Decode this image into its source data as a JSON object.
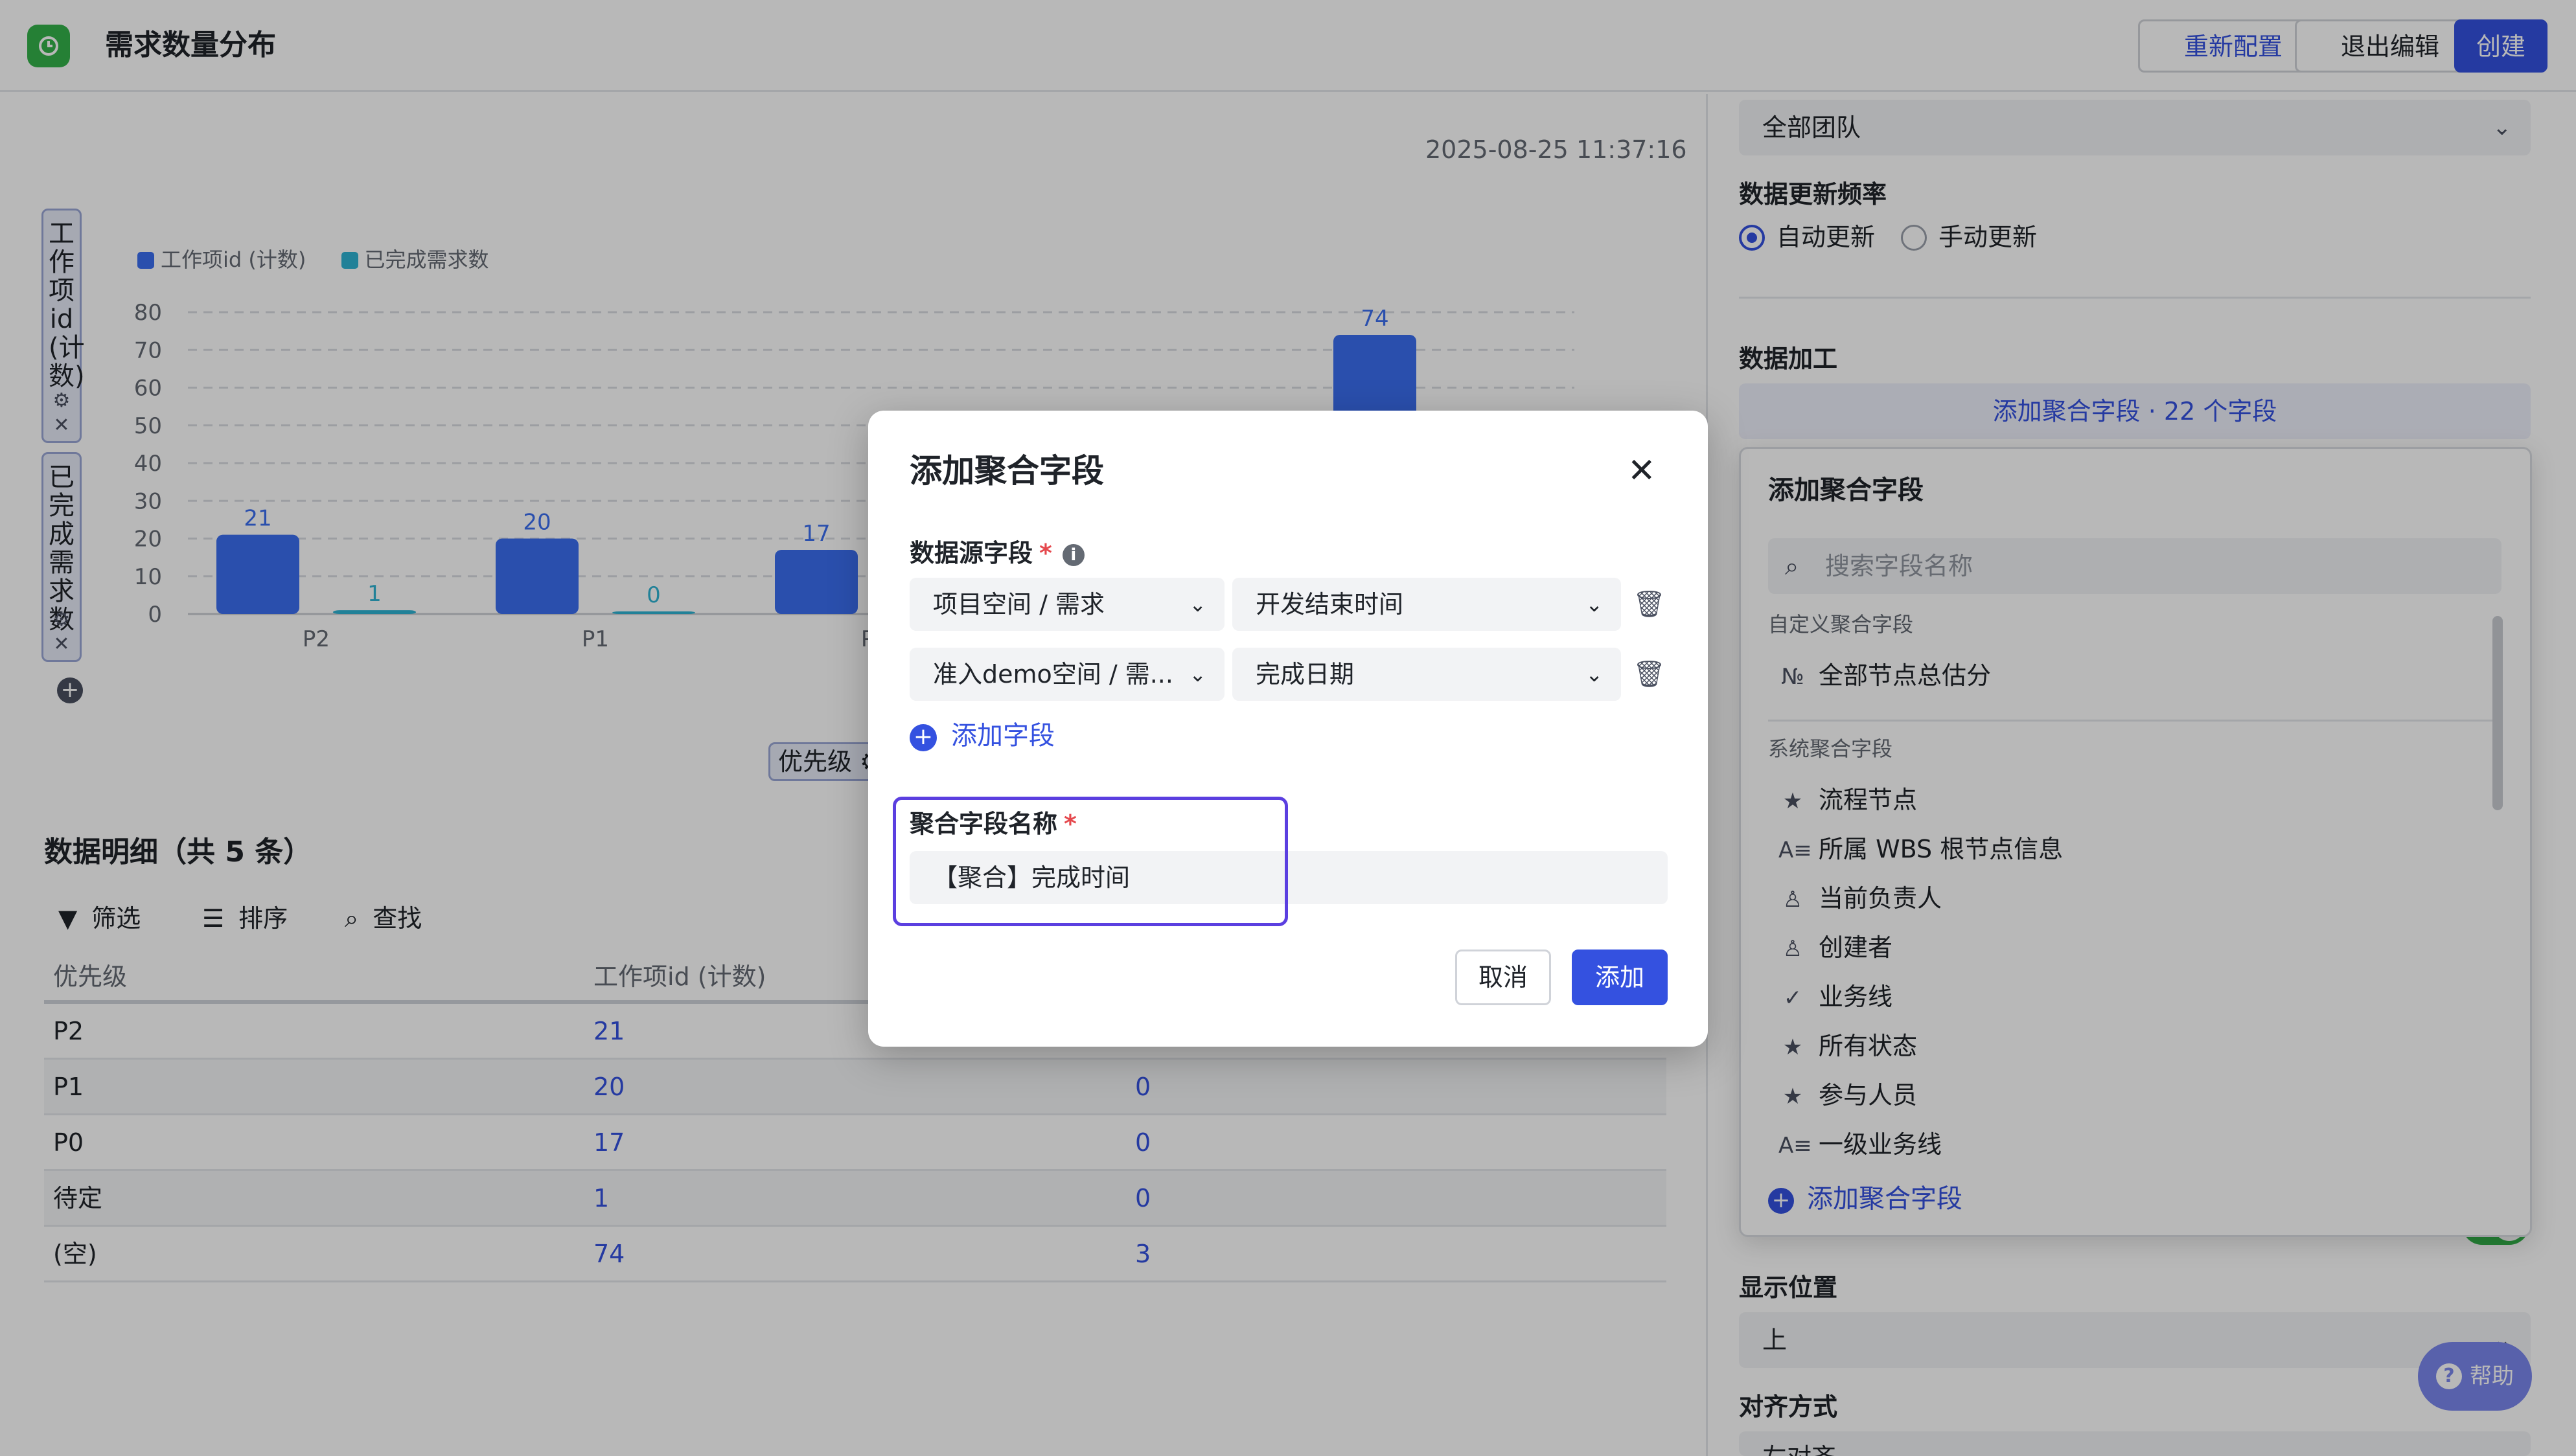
{
  "header": {
    "title": "需求数量分布",
    "reset_label": "重新配置",
    "exit_label": "退出编辑",
    "create_label": "创建"
  },
  "chart_panel": {
    "timestamp": "2025-08-25 11:37:16",
    "y_field_1": "工作项id (计数)",
    "y_field_2": "已完成需求数",
    "x_field": "优先级"
  },
  "chart_data": {
    "type": "bar",
    "categories": [
      "P2",
      "P1",
      "P0",
      "待定",
      "(空)"
    ],
    "series": [
      {
        "name": "工作项id (计数)",
        "values": [
          21,
          20,
          17,
          1,
          74
        ],
        "color": "#3b6ef0"
      },
      {
        "name": "已完成需求数",
        "values": [
          1,
          0,
          0,
          0,
          3
        ],
        "color": "#2fb3d3"
      }
    ],
    "ylim": [
      0,
      80
    ],
    "yticks": [
      "0",
      "10",
      "20",
      "30",
      "40",
      "50",
      "60",
      "70",
      "80"
    ],
    "grid": true,
    "legend_position": "top-left"
  },
  "detail": {
    "title": "数据明细（共 5 条）",
    "filter_label": "筛选",
    "sort_label": "排序",
    "find_label": "查找",
    "columns": [
      "优先级",
      "工作项id (计数)"
    ],
    "rows": [
      {
        "priority": "P2",
        "count": "21",
        "done": ""
      },
      {
        "priority": "P1",
        "count": "20",
        "done": "0"
      },
      {
        "priority": "P0",
        "count": "17",
        "done": "0"
      },
      {
        "priority": "待定",
        "count": "1",
        "done": "0"
      },
      {
        "priority": "(空)",
        "count": "74",
        "done": "3"
      }
    ]
  },
  "right": {
    "team_select": "全部团队",
    "freq_title": "数据更新频率",
    "freq_auto": "自动更新",
    "freq_manual": "手动更新",
    "processing_title": "数据加工",
    "agg_button": "添加聚合字段 · 22 个字段",
    "display_position_title": "显示位置",
    "display_position_value": "上",
    "align_title": "对齐方式",
    "align_value": "左对齐",
    "help_label": "帮助"
  },
  "popover": {
    "title": "添加聚合字段",
    "search_placeholder": "搜索字段名称",
    "custom_group": "自定义聚合字段",
    "custom_items": [
      {
        "label": "全部节点总估分",
        "icon": "number-icon"
      }
    ],
    "system_group": "系统聚合字段",
    "system_items": [
      {
        "label": "流程节点",
        "icon": "star-list-icon"
      },
      {
        "label": "所属 WBS 根节点信息",
        "icon": "text-icon"
      },
      {
        "label": "当前负责人",
        "icon": "person-icon"
      },
      {
        "label": "创建者",
        "icon": "person-icon"
      },
      {
        "label": "业务线",
        "icon": "check-circle-icon"
      },
      {
        "label": "所有状态",
        "icon": "star-list-icon"
      },
      {
        "label": "参与人员",
        "icon": "star-list-icon"
      },
      {
        "label": "一级业务线",
        "icon": "text-icon"
      }
    ],
    "add_label": "添加聚合字段"
  },
  "modal": {
    "title": "添加聚合字段",
    "source_label": "数据源字段",
    "rows": [
      {
        "space": "项目空间 / 需求",
        "field": "开发结束时间"
      },
      {
        "space": "准入demo空间 / 需...",
        "field": "完成日期"
      }
    ],
    "add_field_label": "添加字段",
    "name_label": "聚合字段名称",
    "name_value": "【聚合】完成时间",
    "cancel_label": "取消",
    "add_label": "添加"
  }
}
